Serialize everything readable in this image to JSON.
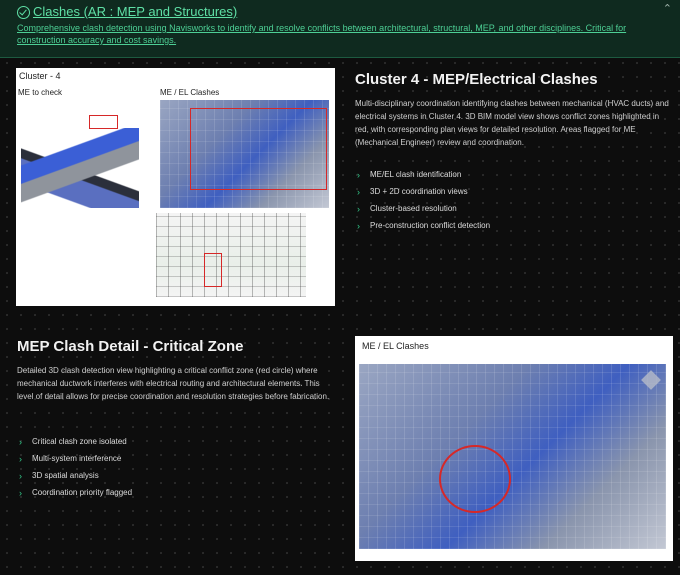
{
  "header": {
    "title": "Clashes (AR : MEP and Structures)",
    "description": "Comprehensive clash detection using Navisworks to identify and resolve conflicts between architectural, structural, MEP, and other disciplines. Critical for construction accuracy and cost savings.",
    "collapse_icon": "chevron-up-icon",
    "accent_color": "#5fe0a6"
  },
  "section1": {
    "image": {
      "title": "Cluster - 4",
      "left_caption": "ME to check",
      "right_caption": "ME / EL Clashes"
    },
    "title": "Cluster 4 - MEP/Electrical Clashes",
    "body": "Multi-disciplinary coordination identifying clashes between mechanical (HVAC ducts) and electrical systems in Cluster 4. 3D BIM model view shows conflict zones highlighted in red, with corresponding plan views for detailed resolution. Areas flagged for ME (Mechanical Engineer) review and coordination.",
    "bullets": [
      "ME/EL clash identification",
      "3D + 2D coordination views",
      "Cluster-based resolution",
      "Pre-construction conflict detection"
    ]
  },
  "section2": {
    "title": "MEP Clash Detail - Critical Zone",
    "body": "Detailed 3D clash detection view highlighting a critical conflict zone (red circle) where mechanical ductwork interferes with electrical routing and architectural elements. This level of detail allows for precise coordination and resolution strategies before fabrication.",
    "bullets": [
      "Critical clash zone isolated",
      "Multi-system interference",
      "3D spatial analysis",
      "Coordination priority flagged"
    ],
    "image": {
      "caption": "ME / EL Clashes"
    }
  },
  "colors": {
    "background": "#0d0d0d",
    "clash_red": "#d62828",
    "bullet_green": "#33c98a"
  }
}
